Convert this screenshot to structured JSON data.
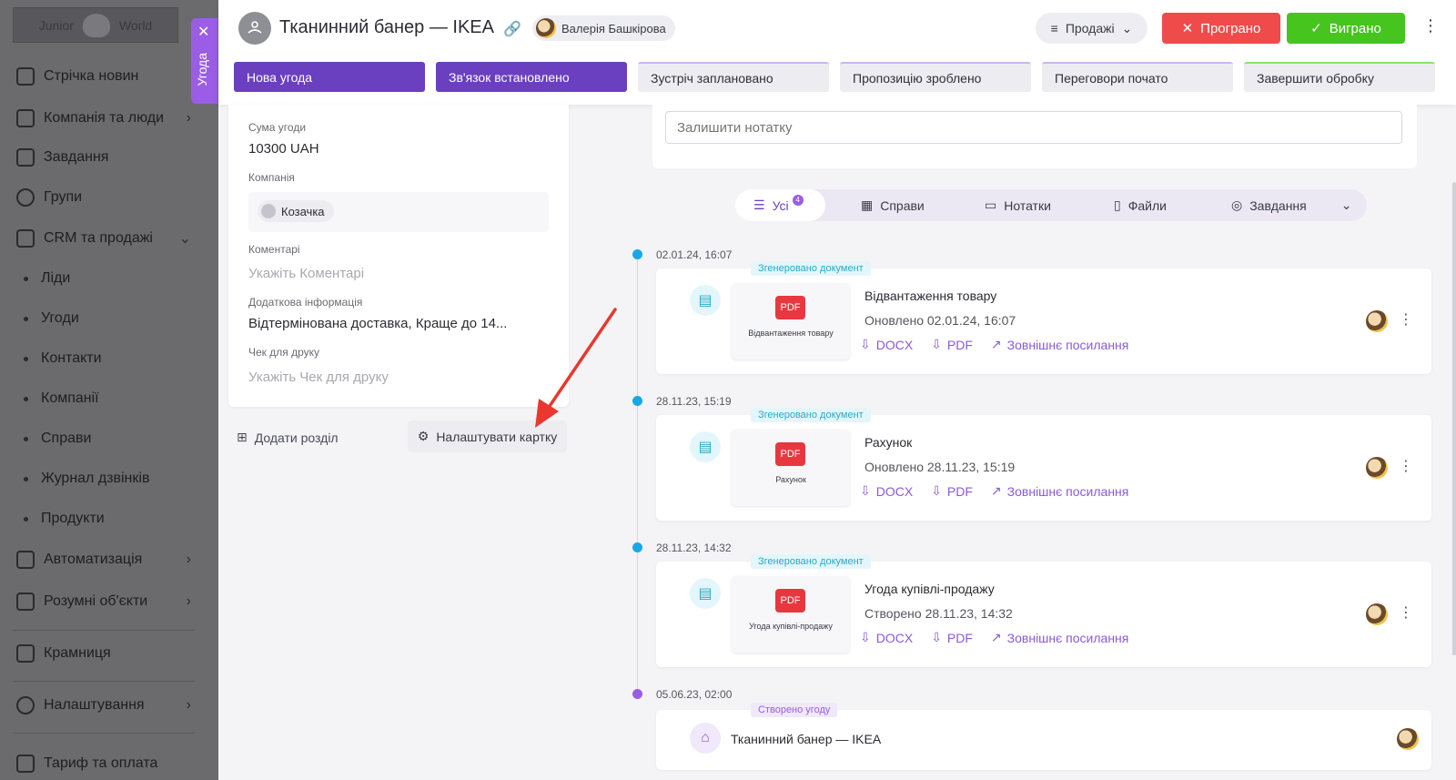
{
  "sidebar": {
    "logo_text_left": "Junior",
    "logo_text_right": "World",
    "items": [
      {
        "label": "Стрічка новин"
      },
      {
        "label": "Компанія та люди"
      },
      {
        "label": "Завдання"
      },
      {
        "label": "Групи"
      },
      {
        "label": "CRM та продажі"
      },
      {
        "label": "Автоматизація"
      },
      {
        "label": "Розумні об'єкти"
      },
      {
        "label": "Крамниця"
      },
      {
        "label": "Налаштування"
      },
      {
        "label": "Тариф та оплата"
      }
    ],
    "crm_sub": [
      "Ліди",
      "Угоди",
      "Контакти",
      "Компанії",
      "Справи",
      "Журнал дзвінків",
      "Продукти"
    ]
  },
  "side_tab": {
    "label": "Угода"
  },
  "header": {
    "title": "Тканинний банер — IKEA",
    "owner": "Валерія Башкірова",
    "pipeline": "Продажі",
    "lost_label": "Програно",
    "won_label": "Виграно"
  },
  "stages": [
    {
      "label": "Нова угода",
      "state": "done"
    },
    {
      "label": "Зв'язок встановлено",
      "state": "done"
    },
    {
      "label": "Зустріч заплановано",
      "state": "todo"
    },
    {
      "label": "Пропозицію зроблено",
      "state": "todo"
    },
    {
      "label": "Переговори почато",
      "state": "todo"
    },
    {
      "label": "Завершити обробку",
      "state": "final"
    }
  ],
  "details": {
    "amount_label": "Сума угоди",
    "amount_value": "10300 UAH",
    "company_label": "Компанія",
    "company_value": "Козачка",
    "comments_label": "Коментарі",
    "comments_placeholder": "Укажіть Коментарі",
    "extra_label": "Додаткова інформація",
    "extra_value": "Відтермінована доставка, Краще до 14...",
    "receipt_label": "Чек для друку",
    "receipt_placeholder": "Укажіть Чек для друку",
    "add_section": "Додати розділ",
    "configure_card": "Налаштувати картку"
  },
  "note": {
    "placeholder": "Залишити нотатку"
  },
  "filters": {
    "all": "Усі",
    "all_count": "4",
    "activities": "Справи",
    "notes": "Нотатки",
    "files": "Файли",
    "tasks": "Завдання"
  },
  "timeline": [
    {
      "date": "02.01.24, 16:07",
      "tag": "Згенеровано документ",
      "thumb_caption": "Відвантаження товару",
      "title": "Відвантаження товару",
      "subtitle": "Оновлено 02.01.24, 16:07",
      "docx": "DOCX",
      "pdf": "PDF",
      "external": "Зовнішнє посилання"
    },
    {
      "date": "28.11.23, 15:19",
      "tag": "Згенеровано документ",
      "thumb_caption": "Рахунок",
      "title": "Рахунок",
      "subtitle": "Оновлено 28.11.23, 15:19",
      "docx": "DOCX",
      "pdf": "PDF",
      "external": "Зовнішнє посилання"
    },
    {
      "date": "28.11.23, 14:32",
      "tag": "Згенеровано документ",
      "thumb_caption": "Угода купівлі-продажу",
      "title": "Угода купівлі-продажу",
      "subtitle": "Створено 28.11.23, 14:32",
      "docx": "DOCX",
      "pdf": "PDF",
      "external": "Зовнішнє посилання"
    },
    {
      "date": "05.06.23, 02:00",
      "tag": "Створено угоду",
      "title": "Тканинний банер — IKEA"
    }
  ],
  "pdf_badge": "PDF",
  "colors": {
    "accent": "#6a3fc0",
    "lost": "#f04b4b",
    "won": "#45c51e",
    "annotation_arrow": "#e8382f"
  }
}
